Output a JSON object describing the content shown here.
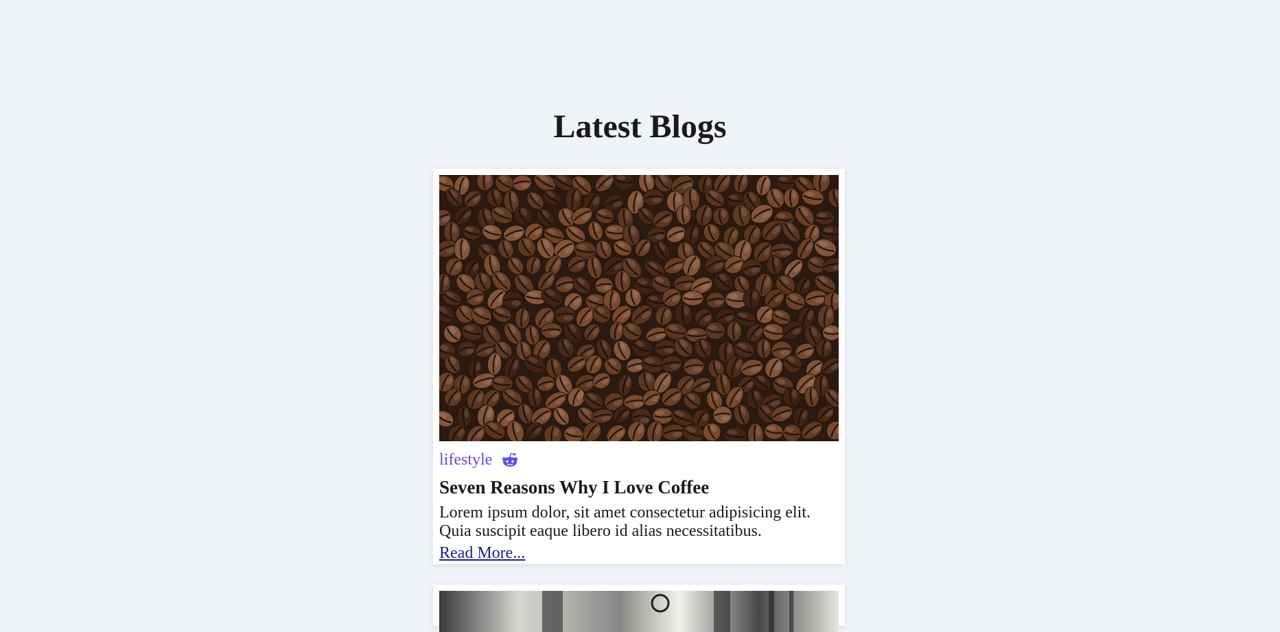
{
  "page": {
    "title": "Latest Blogs"
  },
  "posts": [
    {
      "image_alt": "coffee beans",
      "category": "lifestyle",
      "share_icon": "reddit-icon",
      "title": "Seven Reasons Why I Love Coffee",
      "excerpt": "Lorem ipsum dolor, sit amet consectetur adipisicing elit. Quia suscipit eaque libero id alias necessitatibus.",
      "read_more": "Read More..."
    },
    {
      "image_alt": "black and white photo"
    }
  ],
  "colors": {
    "background": "#f0f3f8",
    "category": "#5b4fe8",
    "link": "#1f1a8c",
    "card": "#ffffff"
  }
}
